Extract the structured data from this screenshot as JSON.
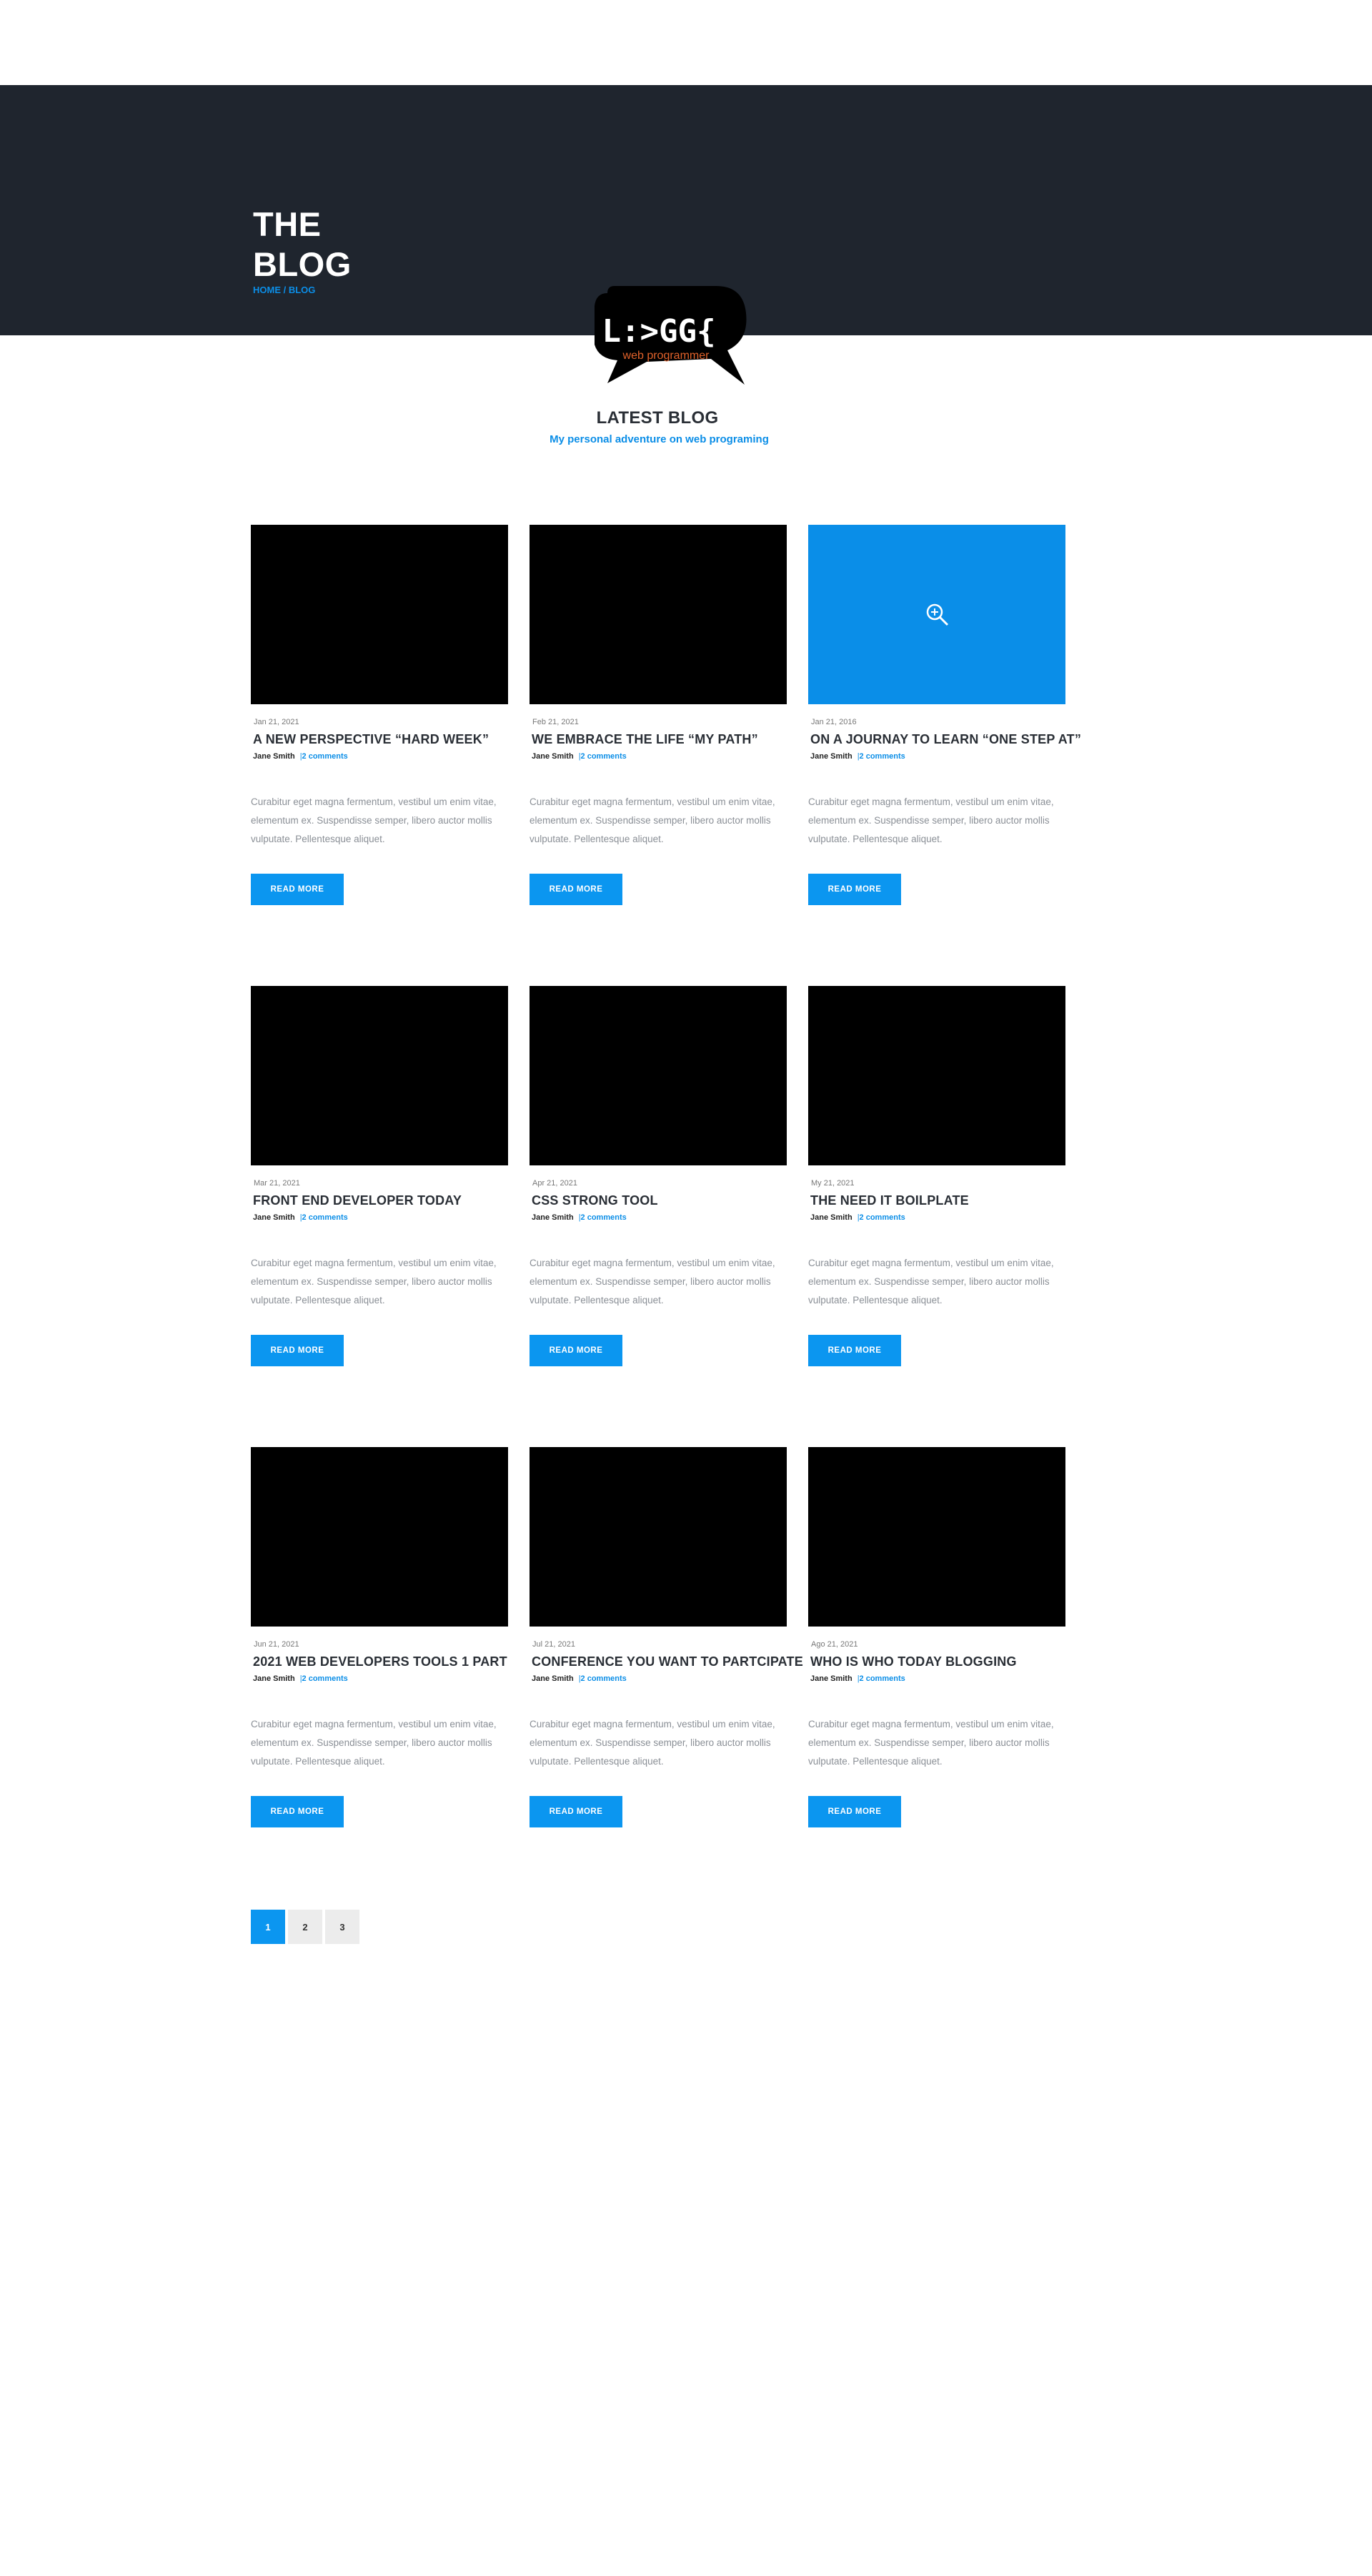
{
  "hero": {
    "title_line1": "THE",
    "title_line2": "BLOG",
    "breadcrumb_home": "HOME",
    "breadcrumb_sep": " / ",
    "breadcrumb_current": "BLOG"
  },
  "logo": {
    "mark": "L:>GG{",
    "tagline": "web programmer"
  },
  "section": {
    "title": "LATEST BLOG",
    "subtitle": "My personal adventure on web programing"
  },
  "posts": [
    {
      "date": "Jan 21, 2021",
      "title": "A NEW PERSPECTIVE  “HARD WEEK”",
      "author": "Jane Smith",
      "comments": "2 comments",
      "excerpt": "Curabitur eget magna fermentum, vestibul um enim vitae, elementum ex. Suspendisse semper, libero auctor mollis vulputate. Pellentesque aliquet.",
      "button": "READ MORE"
    },
    {
      "date": "Feb 21, 2021",
      "title": "WE EMBRACE THE LIFE  “MY PATH”",
      "author": "Jane Smith",
      "comments": "2 comments",
      "excerpt": "Curabitur eget magna fermentum, vestibul um enim vitae, elementum ex. Suspendisse semper, libero auctor mollis vulputate. Pellentesque aliquet.",
      "button": "READ MORE"
    },
    {
      "date": "Jan 21, 2016",
      "title": "ON A JOURNAY TO LEARN “ONE STEP AT”",
      "author": "Jane Smith",
      "comments": "2 comments",
      "excerpt": "Curabitur eget magna fermentum, vestibul um enim vitae, elementum ex. Suspendisse semper, libero auctor mollis vulputate. Pellentesque aliquet.",
      "button": "READ MORE"
    },
    {
      "date": "Mar 21, 2021",
      "title": "FRONT END DEVELOPER TODAY",
      "author": "Jane Smith",
      "comments": "2 comments",
      "excerpt": "Curabitur eget magna fermentum, vestibul um enim vitae, elementum ex. Suspendisse semper, libero auctor mollis vulputate. Pellentesque aliquet.",
      "button": "READ MORE"
    },
    {
      "date": "Apr 21, 2021",
      "title": "CSS STRONG TOOL",
      "author": "Jane Smith",
      "comments": "2 comments",
      "excerpt": "Curabitur eget magna fermentum, vestibul um enim vitae, elementum ex. Suspendisse semper, libero auctor mollis vulputate. Pellentesque aliquet.",
      "button": "READ MORE"
    },
    {
      "date": "My 21, 2021",
      "title": "THE NEED IT BOILPLATE",
      "author": "Jane Smith",
      "comments": "2 comments",
      "excerpt": "Curabitur eget magna fermentum, vestibul um enim vitae, elementum ex. Suspendisse semper, libero auctor mollis vulputate. Pellentesque aliquet.",
      "button": "READ MORE"
    },
    {
      "date": "Jun 21, 2021",
      "title": "2021  WEB DEVELOPERS TOOLS  1 PART",
      "author": "Jane Smith",
      "comments": "2 comments",
      "excerpt": "Curabitur eget magna fermentum, vestibul um enim vitae, elementum ex. Suspendisse semper, libero auctor mollis vulputate. Pellentesque aliquet.",
      "button": "READ MORE"
    },
    {
      "date": "Jul 21, 2021",
      "title": "CONFERENCE  YOU WANT TO PARTCIPATE",
      "author": "Jane Smith",
      "comments": "2 comments",
      "excerpt": "Curabitur eget magna fermentum, vestibul um enim vitae, elementum ex. Suspendisse semper, libero auctor mollis vulputate. Pellentesque aliquet.",
      "button": "READ MORE"
    },
    {
      "date": "Ago 21, 2021",
      "title": "WHO IS WHO TODAY BLOGGING",
      "author": "Jane Smith",
      "comments": "2 comments",
      "excerpt": "Curabitur eget magna fermentum, vestibul um enim vitae, elementum ex. Suspendisse semper, libero auctor mollis vulputate. Pellentesque aliquet.",
      "button": "READ MORE"
    }
  ],
  "pagination": {
    "pages": [
      "1",
      "2",
      "3"
    ],
    "active": "1"
  },
  "colors": {
    "hero_bg": "#1f252e",
    "accent": "#0b96f0",
    "thumb": "#000000",
    "thumb_hover": "#0a8ee8"
  }
}
